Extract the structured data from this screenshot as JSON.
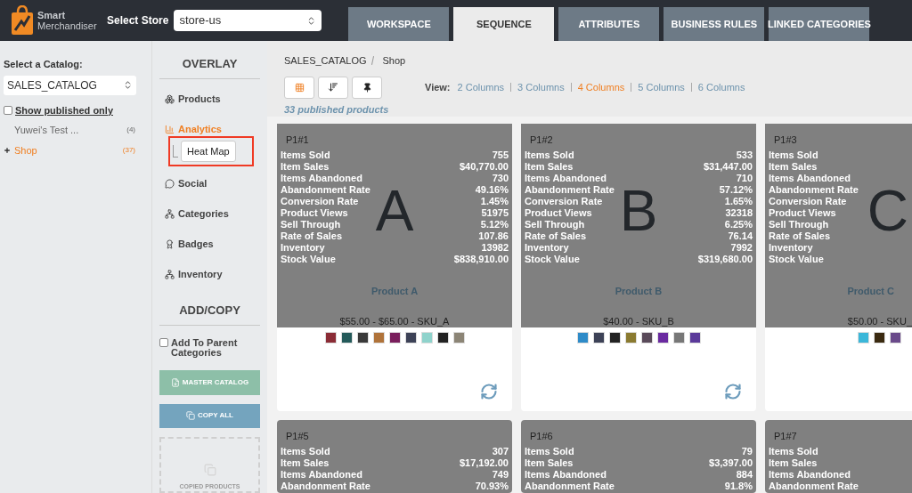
{
  "header": {
    "logo_line_1": "Smart",
    "logo_line_2": "Merchandiser",
    "store_label": "Select Store",
    "store_value": "store-us"
  },
  "tabs": [
    {
      "label": "WORKSPACE",
      "selected": false
    },
    {
      "label": "SEQUENCE",
      "selected": true
    },
    {
      "label": "ATTRIBUTES",
      "selected": false
    },
    {
      "label": "BUSINESS RULES",
      "selected": false
    },
    {
      "label": "LINKED CATEGORIES",
      "selected": false
    }
  ],
  "catalog_panel": {
    "label": "Select a Catalog:",
    "catalog": "SALES_CATALOG",
    "show_published": {
      "label": "Show published only",
      "checked": false
    },
    "tree": [
      {
        "label": "Yuwei's Test ...",
        "count": "(4)",
        "selected": false,
        "expandable": false
      },
      {
        "label": "Shop",
        "count": "(37)",
        "selected": true,
        "expandable": true
      }
    ]
  },
  "overlay": {
    "title": "OVERLAY",
    "items": [
      {
        "label": "Products",
        "selected": false
      },
      {
        "label": "Analytics",
        "selected": true,
        "children": [
          {
            "label": "Heat Map",
            "highlighted": true
          }
        ]
      },
      {
        "label": "Social",
        "selected": false
      },
      {
        "label": "Categories",
        "selected": false
      },
      {
        "label": "Badges",
        "selected": false
      },
      {
        "label": "Inventory",
        "selected": false
      }
    ]
  },
  "add_copy": {
    "title": "ADD/COPY",
    "add_to_parent": {
      "label": "Add To Parent Categories",
      "checked": false
    },
    "master_button": "MASTER CATALOG",
    "copy_button": "COPY ALL",
    "drop_zone": "COPIED PRODUCTS"
  },
  "breadcrumb": [
    "SALES_CATALOG",
    "Shop"
  ],
  "views": {
    "label": "View:",
    "options": [
      {
        "label": "2 Columns",
        "selected": false
      },
      {
        "label": "3 Columns",
        "selected": false
      },
      {
        "label": "4 Columns",
        "selected": true
      },
      {
        "label": "5 Columns",
        "selected": false
      },
      {
        "label": "6 Columns",
        "selected": false
      }
    ]
  },
  "published_count": "33 published products",
  "product_rows": [
    {
      "cards": [
        {
          "position": "P1#1",
          "letter": "A",
          "name": "Product A",
          "price": "$55.00 - $65.00 - SKU_A",
          "metrics": [
            {
              "label": "Items Sold",
              "value": "755"
            },
            {
              "label": "Item Sales",
              "value": "$40,770.00"
            },
            {
              "label": "Items Abandoned",
              "value": "730"
            },
            {
              "label": "Abandonment Rate",
              "value": "49.16%"
            },
            {
              "label": "Conversion Rate",
              "value": "1.45%"
            },
            {
              "label": "Product Views",
              "value": "51975"
            },
            {
              "label": "Sell Through",
              "value": "5.12%"
            },
            {
              "label": "Rate of Sales",
              "value": "107.86"
            },
            {
              "label": "Inventory",
              "value": "13982"
            },
            {
              "label": "Stock Value",
              "value": "$838,910.00"
            }
          ],
          "swatches": [
            {
              "color": "#8b2c36"
            },
            {
              "color": "#245a5a"
            },
            {
              "color": "#3a3a3a"
            },
            {
              "color": "#b0733a"
            },
            {
              "color": "#7a1e5c"
            },
            {
              "color": "#3d4257"
            },
            {
              "color": "#8fd3cc"
            },
            {
              "color": "#222222"
            },
            {
              "color": "#8c8576"
            }
          ]
        },
        {
          "position": "P1#2",
          "letter": "B",
          "name": "Product B",
          "price": "$40.00 - SKU_B",
          "metrics": [
            {
              "label": "Items Sold",
              "value": "533"
            },
            {
              "label": "Item Sales",
              "value": "$31,447.00"
            },
            {
              "label": "Items Abandoned",
              "value": "710"
            },
            {
              "label": "Abandonment Rate",
              "value": "57.12%"
            },
            {
              "label": "Conversion Rate",
              "value": "1.65%"
            },
            {
              "label": "Product Views",
              "value": "32318"
            },
            {
              "label": "Sell Through",
              "value": "6.25%"
            },
            {
              "label": "Rate of Sales",
              "value": "76.14"
            },
            {
              "label": "Inventory",
              "value": "7992"
            },
            {
              "label": "Stock Value",
              "value": "$319,680.00"
            }
          ],
          "swatches": [
            {
              "color": "#2e8bc8"
            },
            {
              "color": "#3d4257"
            },
            {
              "color": "#222222"
            },
            {
              "color": "#8a7a30"
            },
            {
              "color": "#5a4a5a"
            },
            {
              "color": "#6a2aa0"
            },
            {
              "color": "#777777"
            },
            {
              "color": "#5b3a9a"
            }
          ]
        },
        {
          "position": "P1#3",
          "letter": "C",
          "name": "Product C",
          "price": "$50.00 - SKU_",
          "metrics": [
            {
              "label": "Items Sold"
            },
            {
              "label": "Item Sales"
            },
            {
              "label": "Items Abandoned"
            },
            {
              "label": "Abandonment Rate"
            },
            {
              "label": "Conversion Rate"
            },
            {
              "label": "Product Views"
            },
            {
              "label": "Sell Through"
            },
            {
              "label": "Rate of Sales"
            },
            {
              "label": "Inventory"
            },
            {
              "label": "Stock Value"
            }
          ],
          "swatches": [
            {
              "color": "#3bb7d9"
            },
            {
              "color": "#3a2a10"
            },
            {
              "color": "#6a4a8a"
            }
          ]
        }
      ]
    },
    {
      "cards": [
        {
          "position": "P1#5",
          "metrics": [
            {
              "label": "Items Sold",
              "value": "307"
            },
            {
              "label": "Item Sales",
              "value": "$17,192.00"
            },
            {
              "label": "Items Abandoned",
              "value": "749"
            },
            {
              "label": "Abandonment Rate",
              "value": "70.93%"
            }
          ]
        },
        {
          "position": "P1#6",
          "metrics": [
            {
              "label": "Items Sold",
              "value": "79"
            },
            {
              "label": "Item Sales",
              "value": "$3,397.00"
            },
            {
              "label": "Items Abandoned",
              "value": "884"
            },
            {
              "label": "Abandonment Rate",
              "value": "91.8%"
            }
          ]
        },
        {
          "position": "P1#7",
          "metrics": [
            {
              "label": "Items Sold"
            },
            {
              "label": "Item Sales"
            },
            {
              "label": "Items Abandoned"
            },
            {
              "label": "Abandonment Rate"
            }
          ]
        }
      ]
    }
  ]
}
